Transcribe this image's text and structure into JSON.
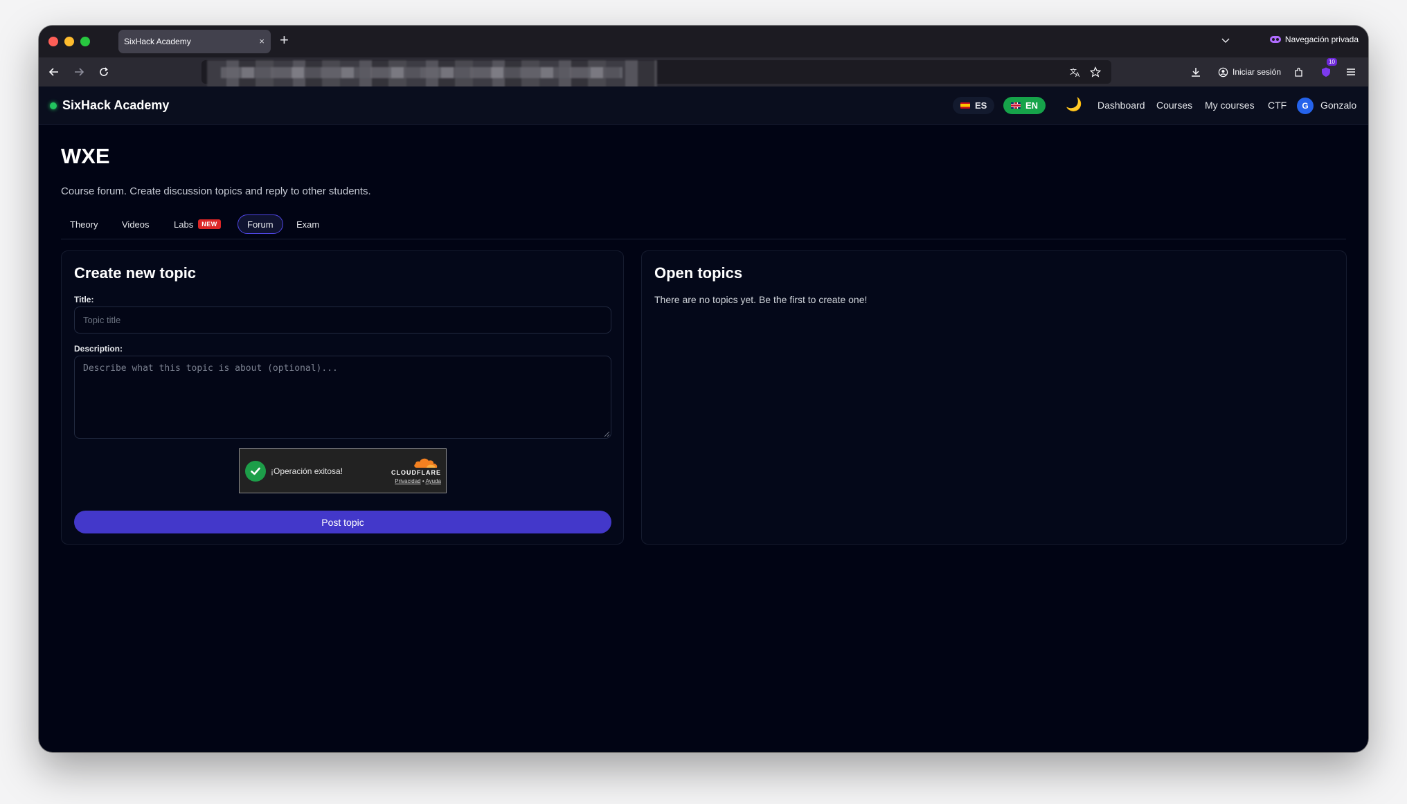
{
  "browser": {
    "tab_title": "SixHack Academy",
    "tab_close": "×",
    "new_tab": "+",
    "private_label": "Navegación privada",
    "signin_label": "Iniciar sesión",
    "extension_badge": "10"
  },
  "header": {
    "brand": "SixHack Academy",
    "lang_es": "ES",
    "lang_en": "EN",
    "theme_icon": "🌙",
    "nav": {
      "dashboard": "Dashboard",
      "courses": "Courses",
      "my_courses": "My courses",
      "ctf": "CTF"
    },
    "avatar_initial": "G",
    "user_name": "Gonzalo"
  },
  "page": {
    "title": "WXE",
    "subtitle": "Course forum. Create discussion topics and reply to other students.",
    "tabs": {
      "theory": "Theory",
      "videos": "Videos",
      "labs": "Labs",
      "labs_badge": "NEW",
      "forum": "Forum",
      "exam": "Exam"
    },
    "active_tab": "forum"
  },
  "create_topic": {
    "heading": "Create new topic",
    "title_label": "Title:",
    "title_placeholder": "Topic title",
    "description_label": "Description:",
    "description_placeholder": "Describe what this topic is about (optional)...",
    "captcha": {
      "message": "¡Operación exitosa!",
      "brand": "CLOUDFLARE",
      "privacy": "Privacidad",
      "separator": "•",
      "help": "Ayuda"
    },
    "submit_label": "Post topic"
  },
  "open_topics": {
    "heading": "Open topics",
    "empty_message": "There are no topics yet. Be the first to create one!"
  },
  "colors": {
    "accent": "#4338ca",
    "success": "#16a34a",
    "background": "#010414",
    "new_badge": "#dc2626"
  }
}
